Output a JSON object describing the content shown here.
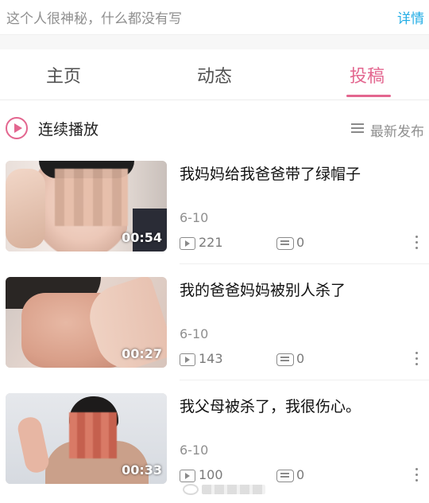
{
  "bio": {
    "text": "这个人很神秘，什么都没有写",
    "details_link": "详情"
  },
  "tabs": [
    {
      "label": "主页",
      "active": false
    },
    {
      "label": "动态",
      "active": false
    },
    {
      "label": "投稿",
      "active": true
    }
  ],
  "playlist": {
    "play_label": "连续播放",
    "sort_label": "最新发布"
  },
  "colors": {
    "accent": "#e3668f",
    "link": "#23ade5",
    "muted": "#8f8f8f"
  },
  "videos": [
    {
      "title": "我妈妈给我爸爸带了绿帽子",
      "duration": "00:54",
      "date": "6-10",
      "views": "221",
      "comments": "0"
    },
    {
      "title": "我的爸爸妈妈被别人杀了",
      "duration": "00:27",
      "date": "6-10",
      "views": "143",
      "comments": "0"
    },
    {
      "title": "我父母被杀了，我很伤心。",
      "duration": "00:33",
      "date": "6-10",
      "views": "100",
      "comments": "0"
    }
  ]
}
